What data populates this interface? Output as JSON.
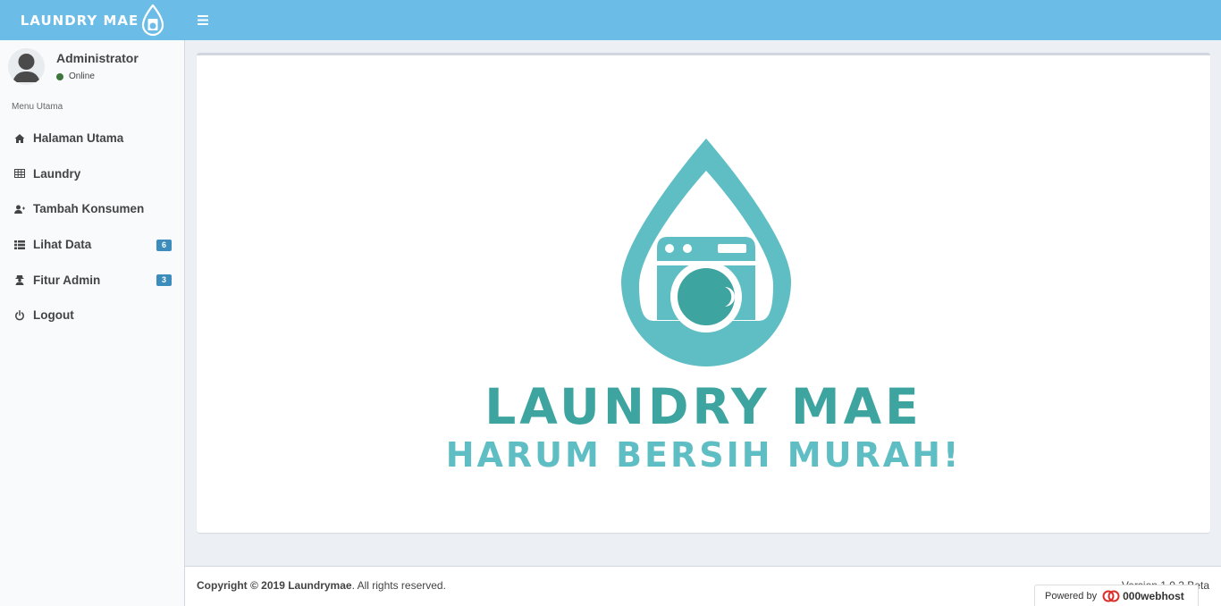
{
  "header": {
    "brand_text": "LAUNDRY MAE",
    "menu_toggle_icon": "bars-icon"
  },
  "sidebar": {
    "user": {
      "name": "Administrator",
      "status": "Online",
      "status_color": "#3c763d"
    },
    "menu_header": "Menu Utama",
    "items": [
      {
        "label": "Halaman Utama",
        "icon": "home-icon"
      },
      {
        "label": "Laundry",
        "icon": "table-icon"
      },
      {
        "label": "Tambah Konsumen",
        "icon": "user-plus-icon"
      },
      {
        "label": "Lihat Data",
        "icon": "list-icon",
        "badge": "6"
      },
      {
        "label": "Fitur Admin",
        "icon": "user-secret-icon",
        "badge": "3"
      },
      {
        "label": "Logout",
        "icon": "power-off-icon"
      }
    ]
  },
  "main": {
    "hero_title": "LAUNDRY MAE",
    "hero_tagline": "HARUM BERSIH MURAH!"
  },
  "footer": {
    "copyright_prefix": "Copyright © 2019 Laundrymae",
    "copyright_suffix": ". All rights reserved.",
    "version": "Version 1.0.2 Beta",
    "powered_by": "Powered by",
    "powered_brand": "000webhost"
  },
  "colors": {
    "topbar": "#6cbce8",
    "brand_teal_dark": "#3ea4a0",
    "brand_teal_light": "#5ebec4",
    "badge": "#3c8dbc"
  }
}
